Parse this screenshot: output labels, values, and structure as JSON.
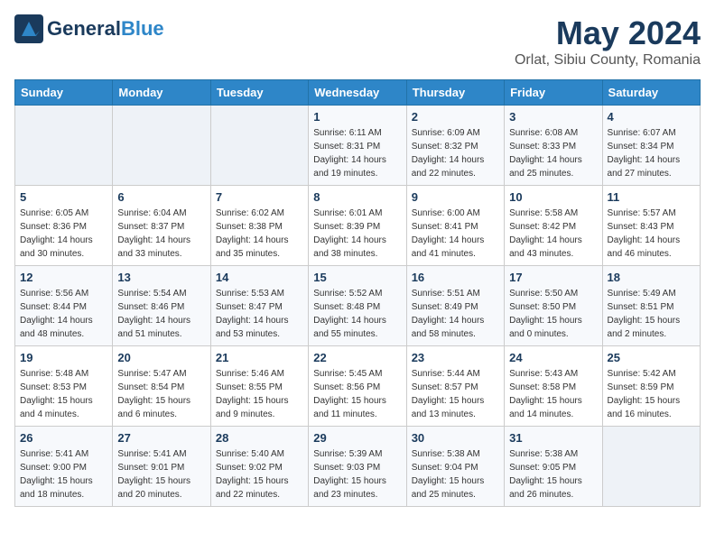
{
  "header": {
    "logo_general": "General",
    "logo_blue": "Blue",
    "month_year": "May 2024",
    "location": "Orlat, Sibiu County, Romania"
  },
  "calendar": {
    "days_of_week": [
      "Sunday",
      "Monday",
      "Tuesday",
      "Wednesday",
      "Thursday",
      "Friday",
      "Saturday"
    ],
    "weeks": [
      [
        {
          "day": "",
          "info": ""
        },
        {
          "day": "",
          "info": ""
        },
        {
          "day": "",
          "info": ""
        },
        {
          "day": "1",
          "info": "Sunrise: 6:11 AM\nSunset: 8:31 PM\nDaylight: 14 hours\nand 19 minutes."
        },
        {
          "day": "2",
          "info": "Sunrise: 6:09 AM\nSunset: 8:32 PM\nDaylight: 14 hours\nand 22 minutes."
        },
        {
          "day": "3",
          "info": "Sunrise: 6:08 AM\nSunset: 8:33 PM\nDaylight: 14 hours\nand 25 minutes."
        },
        {
          "day": "4",
          "info": "Sunrise: 6:07 AM\nSunset: 8:34 PM\nDaylight: 14 hours\nand 27 minutes."
        }
      ],
      [
        {
          "day": "5",
          "info": "Sunrise: 6:05 AM\nSunset: 8:36 PM\nDaylight: 14 hours\nand 30 minutes."
        },
        {
          "day": "6",
          "info": "Sunrise: 6:04 AM\nSunset: 8:37 PM\nDaylight: 14 hours\nand 33 minutes."
        },
        {
          "day": "7",
          "info": "Sunrise: 6:02 AM\nSunset: 8:38 PM\nDaylight: 14 hours\nand 35 minutes."
        },
        {
          "day": "8",
          "info": "Sunrise: 6:01 AM\nSunset: 8:39 PM\nDaylight: 14 hours\nand 38 minutes."
        },
        {
          "day": "9",
          "info": "Sunrise: 6:00 AM\nSunset: 8:41 PM\nDaylight: 14 hours\nand 41 minutes."
        },
        {
          "day": "10",
          "info": "Sunrise: 5:58 AM\nSunset: 8:42 PM\nDaylight: 14 hours\nand 43 minutes."
        },
        {
          "day": "11",
          "info": "Sunrise: 5:57 AM\nSunset: 8:43 PM\nDaylight: 14 hours\nand 46 minutes."
        }
      ],
      [
        {
          "day": "12",
          "info": "Sunrise: 5:56 AM\nSunset: 8:44 PM\nDaylight: 14 hours\nand 48 minutes."
        },
        {
          "day": "13",
          "info": "Sunrise: 5:54 AM\nSunset: 8:46 PM\nDaylight: 14 hours\nand 51 minutes."
        },
        {
          "day": "14",
          "info": "Sunrise: 5:53 AM\nSunset: 8:47 PM\nDaylight: 14 hours\nand 53 minutes."
        },
        {
          "day": "15",
          "info": "Sunrise: 5:52 AM\nSunset: 8:48 PM\nDaylight: 14 hours\nand 55 minutes."
        },
        {
          "day": "16",
          "info": "Sunrise: 5:51 AM\nSunset: 8:49 PM\nDaylight: 14 hours\nand 58 minutes."
        },
        {
          "day": "17",
          "info": "Sunrise: 5:50 AM\nSunset: 8:50 PM\nDaylight: 15 hours\nand 0 minutes."
        },
        {
          "day": "18",
          "info": "Sunrise: 5:49 AM\nSunset: 8:51 PM\nDaylight: 15 hours\nand 2 minutes."
        }
      ],
      [
        {
          "day": "19",
          "info": "Sunrise: 5:48 AM\nSunset: 8:53 PM\nDaylight: 15 hours\nand 4 minutes."
        },
        {
          "day": "20",
          "info": "Sunrise: 5:47 AM\nSunset: 8:54 PM\nDaylight: 15 hours\nand 6 minutes."
        },
        {
          "day": "21",
          "info": "Sunrise: 5:46 AM\nSunset: 8:55 PM\nDaylight: 15 hours\nand 9 minutes."
        },
        {
          "day": "22",
          "info": "Sunrise: 5:45 AM\nSunset: 8:56 PM\nDaylight: 15 hours\nand 11 minutes."
        },
        {
          "day": "23",
          "info": "Sunrise: 5:44 AM\nSunset: 8:57 PM\nDaylight: 15 hours\nand 13 minutes."
        },
        {
          "day": "24",
          "info": "Sunrise: 5:43 AM\nSunset: 8:58 PM\nDaylight: 15 hours\nand 14 minutes."
        },
        {
          "day": "25",
          "info": "Sunrise: 5:42 AM\nSunset: 8:59 PM\nDaylight: 15 hours\nand 16 minutes."
        }
      ],
      [
        {
          "day": "26",
          "info": "Sunrise: 5:41 AM\nSunset: 9:00 PM\nDaylight: 15 hours\nand 18 minutes."
        },
        {
          "day": "27",
          "info": "Sunrise: 5:41 AM\nSunset: 9:01 PM\nDaylight: 15 hours\nand 20 minutes."
        },
        {
          "day": "28",
          "info": "Sunrise: 5:40 AM\nSunset: 9:02 PM\nDaylight: 15 hours\nand 22 minutes."
        },
        {
          "day": "29",
          "info": "Sunrise: 5:39 AM\nSunset: 9:03 PM\nDaylight: 15 hours\nand 23 minutes."
        },
        {
          "day": "30",
          "info": "Sunrise: 5:38 AM\nSunset: 9:04 PM\nDaylight: 15 hours\nand 25 minutes."
        },
        {
          "day": "31",
          "info": "Sunrise: 5:38 AM\nSunset: 9:05 PM\nDaylight: 15 hours\nand 26 minutes."
        },
        {
          "day": "",
          "info": ""
        }
      ]
    ]
  }
}
